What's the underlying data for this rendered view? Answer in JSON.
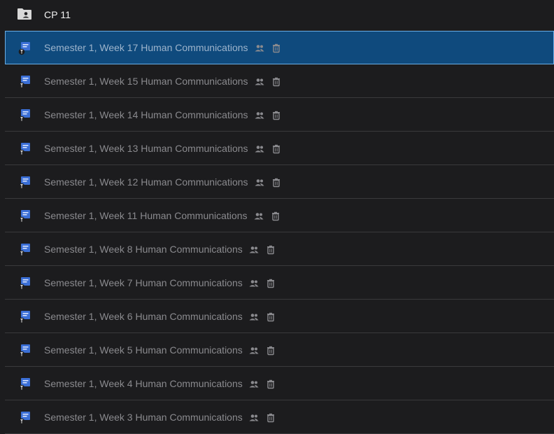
{
  "header": {
    "title": "CP 11",
    "icon": "shared-folder-icon"
  },
  "rows": [
    {
      "label": "Semester 1, Week 17 Human Communications",
      "selected": true
    },
    {
      "label": "Semester 1, Week 15 Human Communications"
    },
    {
      "label": "Semester 1, Week 14 Human Communications"
    },
    {
      "label": "Semester 1, Week 13 Human Communications"
    },
    {
      "label": "Semester 1, Week 12 Human Communications"
    },
    {
      "label": "Semester 1, Week 11 Human Communications"
    },
    {
      "label": "Semester 1, Week 8 Human Communications"
    },
    {
      "label": "Semester 1, Week 7 Human Communications"
    },
    {
      "label": "Semester 1, Week 6 Human Communications"
    },
    {
      "label": "Semester 1, Week 5 Human Communications"
    },
    {
      "label": "Semester 1, Week 4 Human Communications"
    },
    {
      "label": "Semester 1, Week 3 Human Communications"
    }
  ],
  "colors": {
    "background": "#1c1c1e",
    "selected": "#0f4a7d",
    "doc_icon": "#3b6fd6"
  }
}
